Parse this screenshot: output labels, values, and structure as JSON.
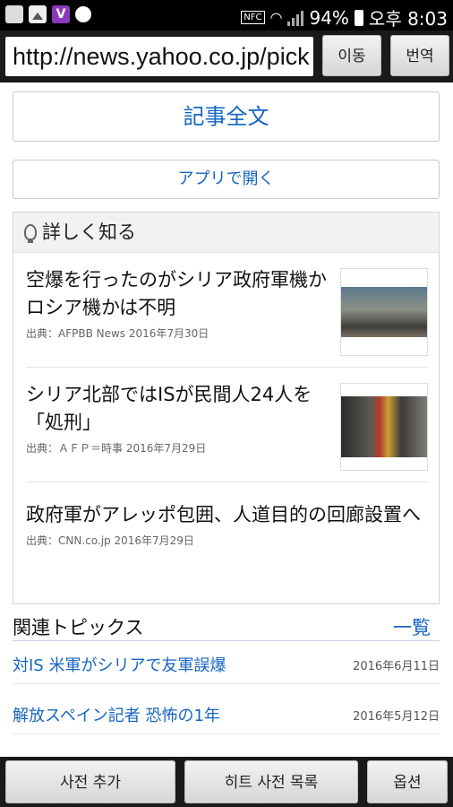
{
  "status_bar": {
    "nfc": "NFC",
    "battery": "94%",
    "time": "오후 8:03"
  },
  "browser": {
    "url": "http://news.yahoo.co.jp/pick",
    "move_label": "이동",
    "translate_label": "번역"
  },
  "article": {
    "full_text_label": "記事全文",
    "open_app_label": "アプリで開く"
  },
  "learn_more": {
    "header": "詳しく知る",
    "items": [
      {
        "title": "空爆を行ったのがシリア政府軍機かロシア機かは不明",
        "meta": "出典：AFPBB News 2016年7月30日"
      },
      {
        "title": "シリア北部ではISが民間人24人を「処刑」",
        "meta": "出典：ＡＦＰ＝時事 2016年7月29日"
      },
      {
        "title": "政府軍がアレッポ包囲、人道目的の回廊設置へ",
        "meta": "出典：CNN.co.jp 2016年7月29日"
      }
    ]
  },
  "topics": {
    "title": "関連トピックス",
    "more_label": "一覧",
    "items": [
      {
        "text": "対IS 米軍がシリアで友軍誤爆",
        "date": "2016年6月11日"
      },
      {
        "text": "解放スペイン記者 恐怖の1年",
        "date": "2016年5月12日"
      }
    ]
  },
  "bottom_bar": {
    "add_dict_label": "사전 추가",
    "hit_dict_label": "히트 사전 목록",
    "options_label": "옵션"
  }
}
